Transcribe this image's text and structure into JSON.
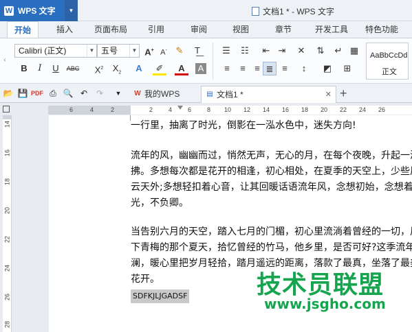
{
  "titlebar": {
    "app_name": "WPS 文字",
    "doc_title": "文档1 * - WPS 文字"
  },
  "menu": {
    "tabs": [
      "开始",
      "插入",
      "页面布局",
      "引用",
      "审阅",
      "视图",
      "章节",
      "开发工具",
      "特色功能"
    ],
    "active_tab": "开始"
  },
  "ribbon": {
    "font_name": "Calibri (正文)",
    "font_size": "五号",
    "style_preview": "AaBbCcDd",
    "style_name": "正文"
  },
  "doc_tabs": {
    "my_wps": "我的WPS",
    "active_doc": "文档1 *"
  },
  "ruler": {
    "h_numbers": [
      "6",
      "4",
      "2",
      "2",
      "4",
      "6",
      "8",
      "10",
      "12",
      "14",
      "16",
      "18",
      "20",
      "22",
      "24",
      "26"
    ],
    "v_numbers": [
      "14",
      "16",
      "18",
      "20",
      "22",
      "24",
      "26",
      "28"
    ]
  },
  "document": {
    "lines": [
      "一行里，抽离了时光，倒影在一泓水色中，迷失方向!",
      "流年的风，幽幽而过，悄然无声，无心的月，在每个夜晚，升起一泓",
      "拂。多想每次都是花开的相逢，初心相处，在夏季的天空上，少些风",
      "云天外;多想轻扣着心音，让其回暖话语流年风，念想初始，念想着",
      "光，不负卿。",
      "当告别六月的天空，踏入七月的门楣，初心里流淌着曾经的一切，风",
      "下青梅的那个夏天，拾忆曾经的竹马，他乡里，是否可好?这季流年",
      "澜，暖心里把岁月轻拾，踏月遥远的距离，落款了最真，坐落了最美",
      "花开。"
    ],
    "selected_text": "SDFKJLJGADSF"
  },
  "watermark": {
    "text": "技术员联盟",
    "url": "www.jsgho.com"
  }
}
